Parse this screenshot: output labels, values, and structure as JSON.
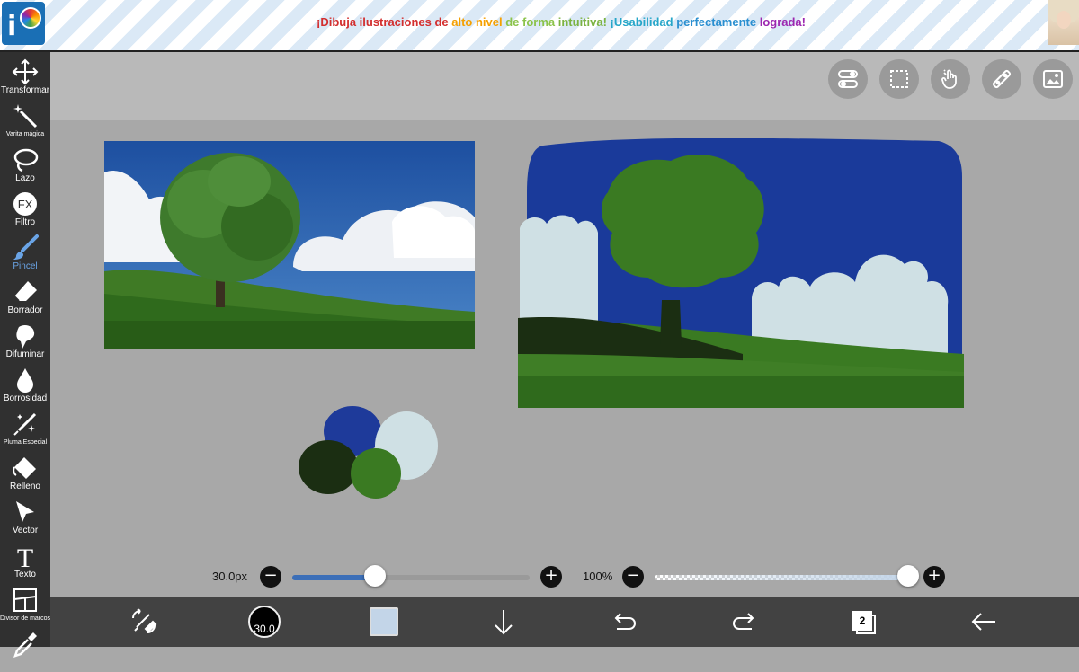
{
  "ad": {
    "segments": [
      {
        "text": "¡Dibuja ilustraciones de ",
        "color": "#d32f2f"
      },
      {
        "text": "alto nivel ",
        "color": "#f5a000"
      },
      {
        "text": "de forma ",
        "color": "#8bc34a"
      },
      {
        "text": "intuitiva! ",
        "color": "#7cb342"
      },
      {
        "text": "¡Usabilidad ",
        "color": "#26a6c9"
      },
      {
        "text": "perfectamente ",
        "color": "#2a8fd0"
      },
      {
        "text": "lograda!",
        "color": "#9c27b0"
      }
    ],
    "logo_icon": "ibispaint-logo",
    "avatar_icon": "avatar-image"
  },
  "toolbar": {
    "tools": [
      {
        "label": "Transformar",
        "icon": "move-arrows-icon"
      },
      {
        "label": "Varita mágica",
        "icon": "magic-wand-icon"
      },
      {
        "label": "Lazo",
        "icon": "lasso-icon"
      },
      {
        "label": "Filtro",
        "icon": "fx-icon"
      },
      {
        "label": "Pincel",
        "icon": "brush-icon",
        "active": true
      },
      {
        "label": "Borrador",
        "icon": "eraser-icon"
      },
      {
        "label": "Difuminar",
        "icon": "smudge-icon"
      },
      {
        "label": "Borrosidad",
        "icon": "blur-drop-icon"
      },
      {
        "label": "Pluma Especial",
        "icon": "special-pen-icon"
      },
      {
        "label": "Relleno",
        "icon": "fill-bucket-icon"
      },
      {
        "label": "Vector",
        "icon": "vector-arrow-icon"
      },
      {
        "label": "Texto",
        "icon": "text-icon"
      },
      {
        "label": "Divisor de marcos",
        "icon": "frame-divider-icon"
      }
    ],
    "active_color": "#6aa4e6"
  },
  "top_buttons": [
    "settings-toggle-icon",
    "selection-icon",
    "touch-gesture-icon",
    "ruler-icon",
    "reference-image-icon"
  ],
  "sliders": {
    "brush_size": {
      "label": "30.0px",
      "level": 0.35,
      "minus": "−",
      "plus": "+"
    },
    "opacity": {
      "label": "100%",
      "level": 1.0,
      "minus": "−",
      "plus": "+"
    }
  },
  "bottom_bar": {
    "brush_size_value": "30.0",
    "current_color": "#c3d5e8",
    "layer_count": "2",
    "icons": [
      "swap-brush-icon",
      "brush-size-indicator",
      "color-swatch",
      "download-arrow-icon",
      "undo-icon",
      "redo-icon",
      "layers-icon",
      "back-arrow-icon"
    ]
  },
  "palette_colors": [
    "#1e3a9a",
    "#cfe0e4",
    "#1b2e12",
    "#3a7a22"
  ],
  "colors": {
    "canvas": "#a8a8a8",
    "toolbar": "#303030",
    "bottom_bar": "#424242",
    "accent": "#3c6fb8"
  }
}
